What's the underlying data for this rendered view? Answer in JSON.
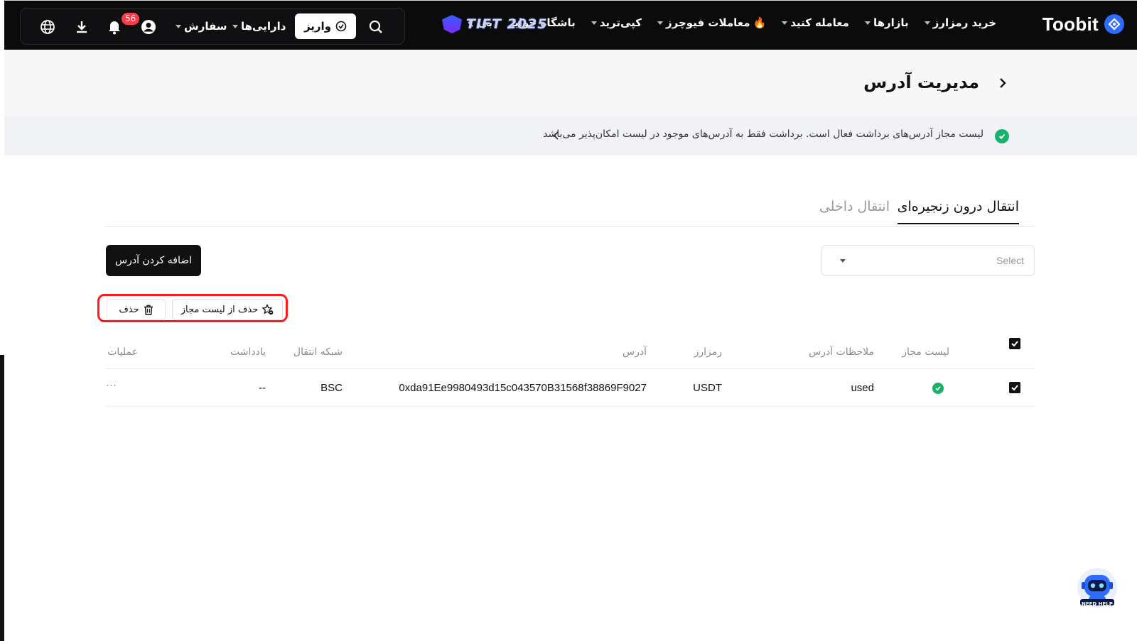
{
  "brand": {
    "name": "Toobit",
    "accent": "#2d6cff"
  },
  "nav": {
    "items": [
      {
        "label": "خرید رمزارز",
        "has_caret": true
      },
      {
        "label": "بازارها",
        "has_caret": true
      },
      {
        "label": "معامله کنید",
        "has_caret": true
      },
      {
        "label": "معاملات فیوچرز",
        "has_caret": true,
        "icon": "fire-icon"
      },
      {
        "label": "کپی‌ترید",
        "has_caret": true
      },
      {
        "label": "باشگاه جوایز",
        "has_caret": false
      },
      {
        "label": "بی",
        "has_caret": false
      }
    ],
    "promo_text": "TIFT 2025"
  },
  "toolbar": {
    "deposit_label": "واریز",
    "assets_label": "دارایی‌ها",
    "orders_label": "سفارش",
    "notification_count": "56"
  },
  "page": {
    "title": "مدیریت آدرس"
  },
  "notice": {
    "text": "لیست مجاز آدرس‌های برداشت فعال است. برداشت فقط به آدرس‌های موجود در لیست امکان‌پذیر می‌باشد"
  },
  "tabs": [
    {
      "label": "انتقال درون زنجیره‌ای",
      "active": true
    },
    {
      "label": "انتقال داخلی",
      "active": false
    }
  ],
  "filter": {
    "placeholder": "Select"
  },
  "actions": {
    "add_address_label": "اضافه کردن آدرس",
    "remove_from_whitelist_label": "حذف از لیست مجاز",
    "delete_label": "حذف"
  },
  "table": {
    "headers": {
      "whitelist": "لیست مجاز",
      "address_notes": "ملاحظات آدرس",
      "currency": "رمزارز",
      "address": "آدرس",
      "network": "شبکه انتقال",
      "memo": "یادداشت",
      "operations": "عملیات"
    },
    "rows": [
      {
        "checked": true,
        "whitelisted": true,
        "address_notes": "used",
        "currency": "USDT",
        "address": "0xda91Ee9980493d15c043570B31568f38869F9027",
        "network": "BSC",
        "memo": "--",
        "operations": "···"
      }
    ]
  },
  "colors": {
    "header_bg": "#0b0b0c",
    "success": "#18b26b",
    "highlight": "#ff1a1a",
    "badge": "#ff3b4a"
  },
  "help": {
    "label": "NEED HELP"
  }
}
